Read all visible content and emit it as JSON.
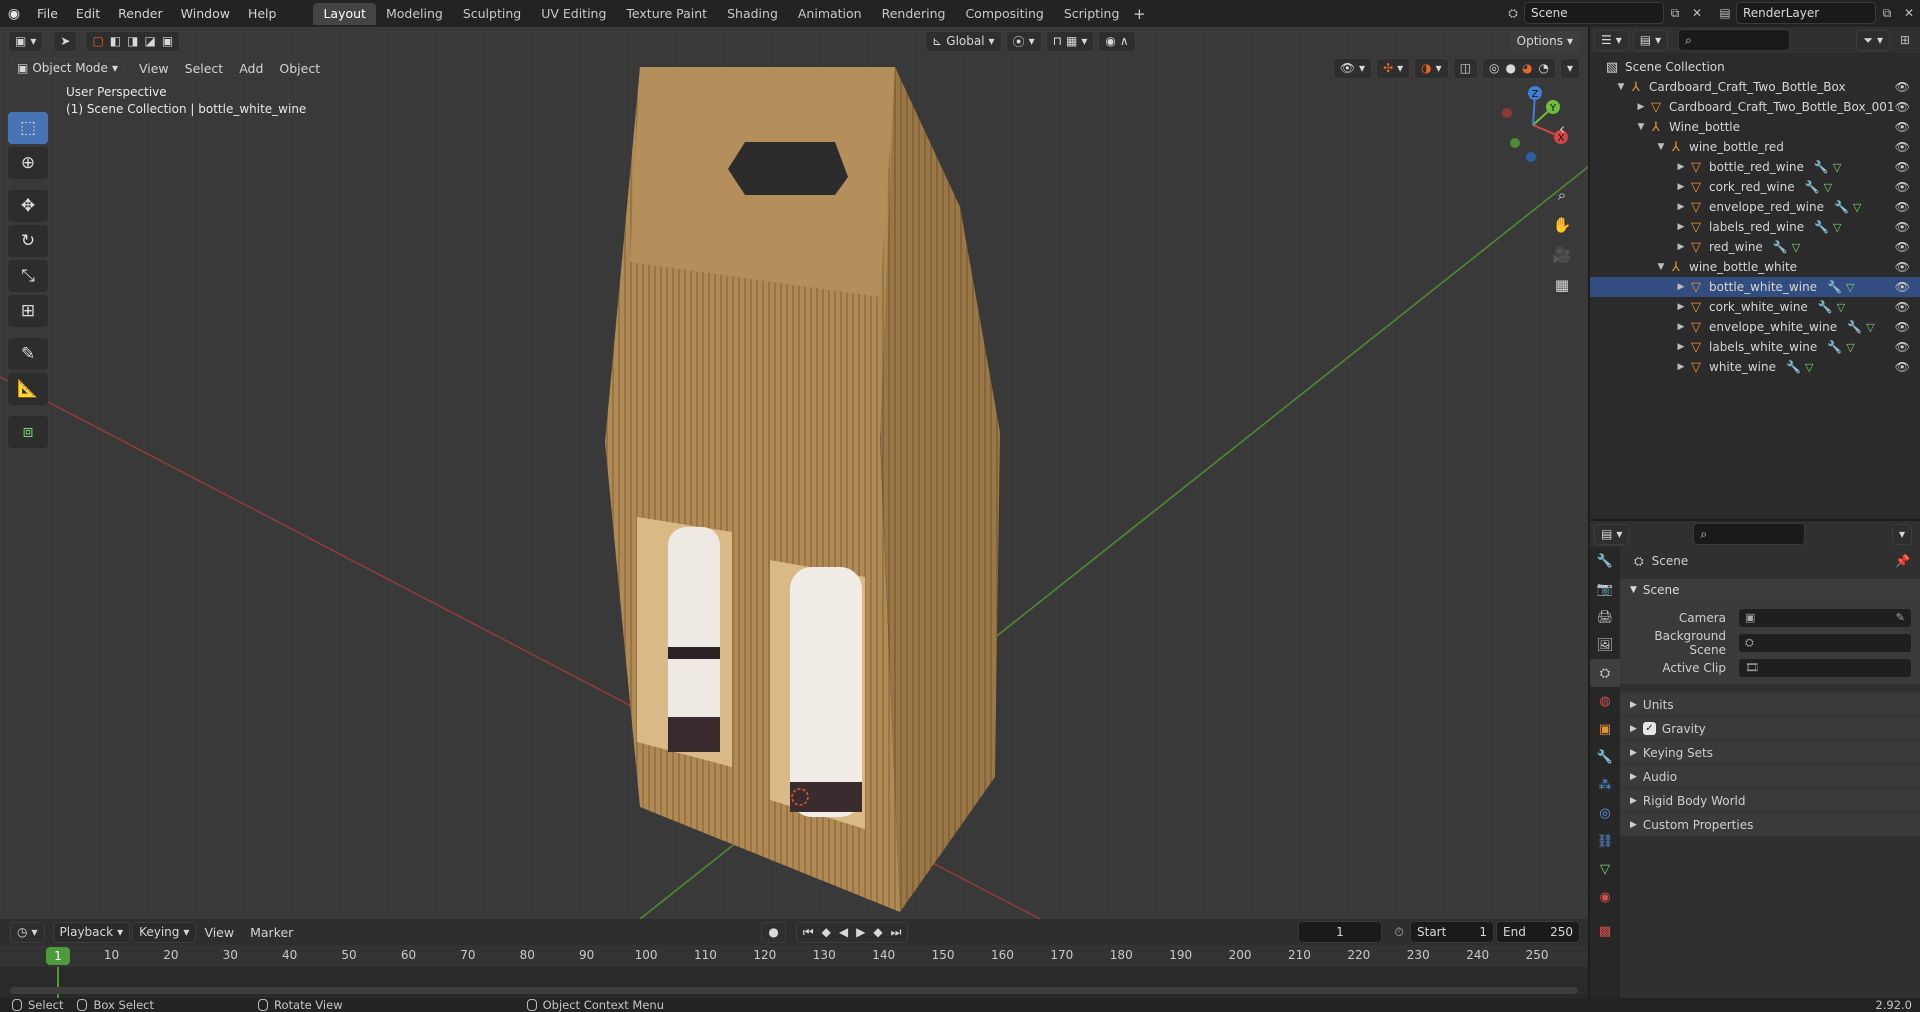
{
  "topbar": {
    "menus": [
      "File",
      "Edit",
      "Render",
      "Window",
      "Help"
    ],
    "workspaces": [
      "Layout",
      "Modeling",
      "Sculpting",
      "UV Editing",
      "Texture Paint",
      "Shading",
      "Animation",
      "Rendering",
      "Compositing",
      "Scripting"
    ],
    "active_workspace": "Layout",
    "add_label": "+",
    "scene_name": "Scene",
    "render_layer": "RenderLayer"
  },
  "viewport": {
    "mode": "Object Mode",
    "menus": [
      "View",
      "Select",
      "Add",
      "Object"
    ],
    "transform_orientation": "Global",
    "options_label": "Options",
    "overlay_line1": "User Perspective",
    "overlay_line2": "(1) Scene Collection | bottle_white_wine",
    "gizmo_axes": {
      "x": "X",
      "y": "Y",
      "z": "Z"
    },
    "colors": {
      "x_axis": "#d44545",
      "y_axis": "#6fbf3c",
      "z_axis": "#3f7fd6",
      "grid_bg": "#393939",
      "cardboard": "#b08a55"
    }
  },
  "timeline": {
    "menus": [
      "Playback",
      "Keying",
      "View",
      "Marker"
    ],
    "current_frame": "1",
    "start_label": "Start",
    "start_value": "1",
    "end_label": "End",
    "end_value": "250",
    "ruler_marks": [
      "10",
      "20",
      "30",
      "40",
      "50",
      "60",
      "70",
      "80",
      "90",
      "100",
      "110",
      "120",
      "130",
      "140",
      "150",
      "160",
      "170",
      "180",
      "190",
      "200",
      "210",
      "220",
      "230",
      "240",
      "250"
    ],
    "frame_marker": "1"
  },
  "statusbar": {
    "select": "Select",
    "box_select": "Box Select",
    "rotate_view": "Rotate View",
    "context_menu": "Object Context Menu",
    "version": "2.92.0"
  },
  "outliner": {
    "root": "Scene Collection",
    "rows": [
      {
        "label": "Cardboard_Craft_Two_Bottle_Box",
        "depth": 1,
        "type": "empty",
        "expanded": true,
        "mods": false
      },
      {
        "label": "Cardboard_Craft_Two_Bottle_Box_001",
        "depth": 2,
        "type": "mesh",
        "expanded": false,
        "mods": false
      },
      {
        "label": "Wine_bottle",
        "depth": 2,
        "type": "empty",
        "expanded": true,
        "mods": false
      },
      {
        "label": "wine_bottle_red",
        "depth": 3,
        "type": "empty",
        "expanded": true,
        "mods": false
      },
      {
        "label": "bottle_red_wine",
        "depth": 4,
        "type": "mesh",
        "expanded": false,
        "mods": true
      },
      {
        "label": "cork_red_wine",
        "depth": 4,
        "type": "mesh",
        "expanded": false,
        "mods": true
      },
      {
        "label": "envelope_red_wine",
        "depth": 4,
        "type": "mesh",
        "expanded": false,
        "mods": true
      },
      {
        "label": "labels_red_wine",
        "depth": 4,
        "type": "mesh",
        "expanded": false,
        "mods": true
      },
      {
        "label": "red_wine",
        "depth": 4,
        "type": "mesh",
        "expanded": false,
        "mods": true
      },
      {
        "label": "wine_bottle_white",
        "depth": 3,
        "type": "empty",
        "expanded": true,
        "mods": false
      },
      {
        "label": "bottle_white_wine",
        "depth": 4,
        "type": "mesh",
        "expanded": false,
        "mods": true,
        "selected": true
      },
      {
        "label": "cork_white_wine",
        "depth": 4,
        "type": "mesh",
        "expanded": false,
        "mods": true
      },
      {
        "label": "envelope_white_wine",
        "depth": 4,
        "type": "mesh",
        "expanded": false,
        "mods": true
      },
      {
        "label": "labels_white_wine",
        "depth": 4,
        "type": "mesh",
        "expanded": false,
        "mods": true
      },
      {
        "label": "white_wine",
        "depth": 4,
        "type": "mesh",
        "expanded": false,
        "mods": true
      }
    ]
  },
  "properties": {
    "context": "Scene",
    "panel_title": "Scene",
    "camera_label": "Camera",
    "background_scene_label": "Background Scene",
    "active_clip_label": "Active Clip",
    "subpanels": [
      "Units",
      "Gravity",
      "Keying Sets",
      "Audio",
      "Rigid Body World",
      "Custom Properties"
    ],
    "gravity_checked": true
  }
}
